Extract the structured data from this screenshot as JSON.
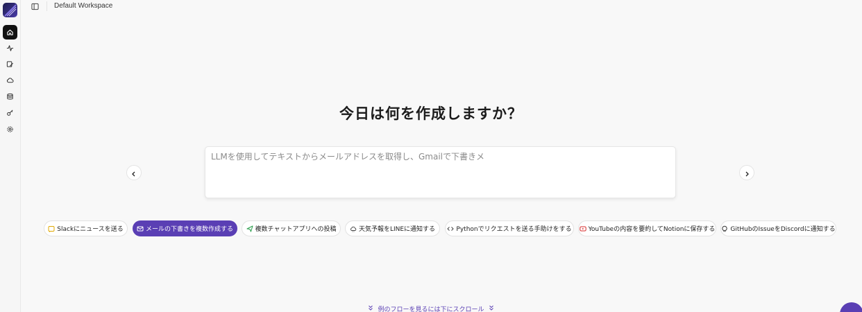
{
  "header": {
    "workspace": "Default Workspace"
  },
  "sidebar": {
    "items": [
      {
        "name": "home-icon"
      },
      {
        "name": "activity-icon"
      },
      {
        "name": "edit-icon"
      },
      {
        "name": "cloud-icon"
      },
      {
        "name": "database-icon"
      },
      {
        "name": "key-icon"
      },
      {
        "name": "settings-icon"
      }
    ]
  },
  "main": {
    "title": "今日は何を作成しますか？",
    "prompt_value": "",
    "prompt_placeholder": "LLMを使用してテキストからメールアドレスを取得し、Gmailで下書きメ",
    "chips": [
      {
        "label": "Slackにニュースを送る",
        "icon": "slack-icon"
      },
      {
        "label": "メールの下書きを複数作成する",
        "icon": "mail-icon",
        "active": true
      },
      {
        "label": "複数チャットアプリへの投稿",
        "icon": "send-icon"
      },
      {
        "label": "天気予報をLINEに通知する",
        "icon": "cloud-icon"
      },
      {
        "label": "Pythonでリクエストを送る手助けをする",
        "icon": "code-icon"
      },
      {
        "label": "YouTubeの内容を要約してNotionに保存する",
        "icon": "youtube-icon"
      },
      {
        "label": "GitHubのIssueをDiscordに通知する",
        "icon": "github-icon"
      }
    ],
    "scroll_hint": "例のフローを見るには下にスクロール"
  },
  "colors": {
    "accent": "#5a3fb4",
    "background": "#f8f8f8"
  }
}
